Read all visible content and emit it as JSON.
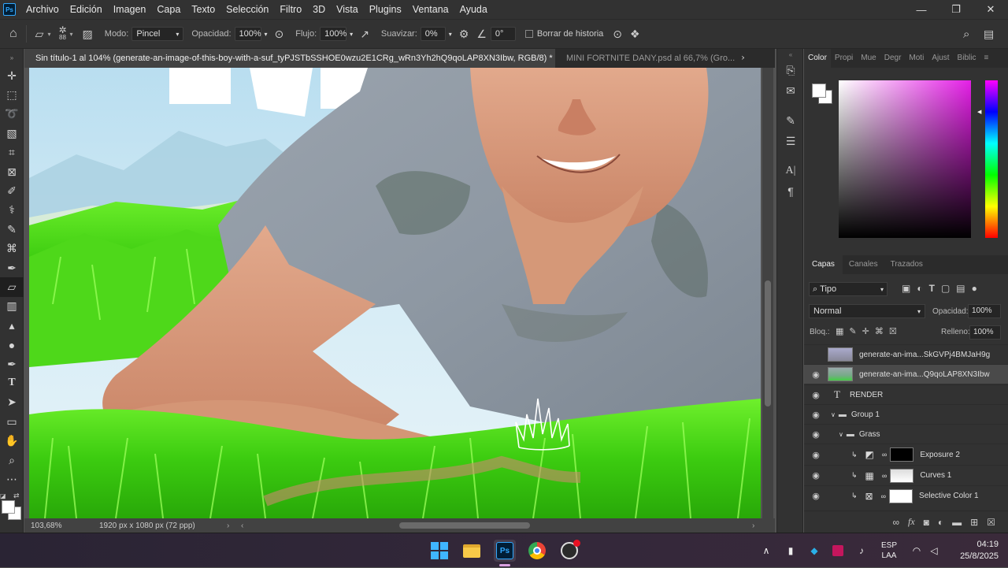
{
  "menu": {
    "logo": "Ps",
    "items": [
      "Archivo",
      "Edición",
      "Imagen",
      "Capa",
      "Texto",
      "Selección",
      "Filtro",
      "3D",
      "Vista",
      "Plugins",
      "Ventana",
      "Ayuda"
    ]
  },
  "options": {
    "brush_size": "88",
    "mode_label": "Modo:",
    "mode_value": "Pincel",
    "opacity_label": "Opacidad:",
    "opacity_value": "100%",
    "flow_label": "Flujo:",
    "flow_value": "100%",
    "smooth_label": "Suavizar:",
    "smooth_value": "0%",
    "angle_value": "0°",
    "erase_history_label": "Borrar de historia"
  },
  "tabs": [
    {
      "label": "Sin título-1 al 104% (generate-an-image-of-this-boy-with-a-suf_tyPJSTbSSHOE0wzu2E1CRg_wRn3Yh2hQ9qoLAP8XN3Ibw, RGB/8) *",
      "close": "×"
    },
    {
      "label": "MINI FORTNITE DANY.psd al 66,7% (Gro...",
      "close": "×"
    }
  ],
  "status": {
    "zoom": "103,68%",
    "doc_size": "1920 px x 1080 px (72 ppp)"
  },
  "color_panel": {
    "tabs": [
      "Color",
      "Propi",
      "Mue",
      "Degr",
      "Moti",
      "Ajust",
      "Biblic"
    ],
    "foreground": "#ffffff",
    "background": "#ffffff"
  },
  "layers_panel": {
    "tabs": [
      "Capas",
      "Canales",
      "Trazados"
    ],
    "filter_value": "Tipo",
    "blend_mode": "Normal",
    "opacity_label": "Opacidad:",
    "opacity_value": "100%",
    "lock_label": "Bloq.:",
    "fill_label": "Relleno:",
    "fill_value": "100%",
    "layers": [
      {
        "name": "generate-an-ima...SkGVPj4BMJaH9g",
        "visible": false,
        "kind": "image",
        "selected": false
      },
      {
        "name": "generate-an-ima...Q9qoLAP8XN3Ibw",
        "visible": true,
        "kind": "image",
        "selected": true
      },
      {
        "name": "RENDER",
        "visible": true,
        "kind": "text",
        "selected": false
      },
      {
        "name": "Group 1",
        "visible": true,
        "kind": "group",
        "selected": false
      },
      {
        "name": "Grass",
        "visible": true,
        "kind": "group",
        "selected": false
      },
      {
        "name": "Exposure 2",
        "visible": true,
        "kind": "adjust",
        "selected": false
      },
      {
        "name": "Curves 1",
        "visible": true,
        "kind": "adjust",
        "selected": false
      },
      {
        "name": "Selective Color 1",
        "visible": true,
        "kind": "adjust",
        "selected": false
      }
    ]
  },
  "taskbar": {
    "lang_line1": "ESP",
    "lang_line2": "LAA",
    "time": "04:19",
    "date": "25/8/2025"
  }
}
